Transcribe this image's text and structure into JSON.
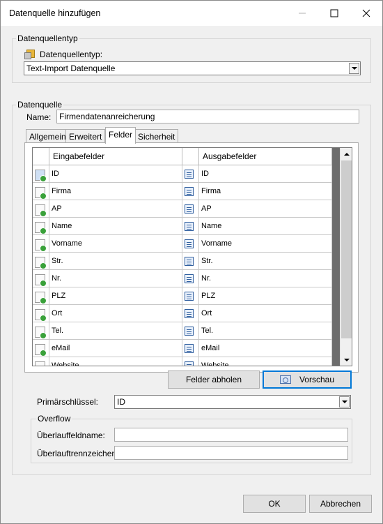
{
  "window": {
    "title": "Datenquelle hinzufügen",
    "controls": {
      "minimize": "—",
      "maximize": "☐",
      "close": "✕"
    }
  },
  "datasource_type_group": {
    "label": "Datenquellentyp",
    "field_label": "Datenquellentyp:",
    "selected": "Text-Import Datenquelle",
    "icon": "database-icon"
  },
  "datasource_group": {
    "label": "Datenquelle",
    "name_label": "Name:",
    "name_value": "Firmendatenanreicherung"
  },
  "tabs": [
    {
      "label": "Allgemein",
      "active": false
    },
    {
      "label": "Erweitert",
      "active": false
    },
    {
      "label": "Felder",
      "active": true
    },
    {
      "label": "Sicherheit",
      "active": false
    }
  ],
  "fields_grid": {
    "columns": [
      "Eingabefelder",
      "Ausgabefelder"
    ],
    "rows": [
      {
        "input": "ID",
        "output": "ID",
        "selected": true
      },
      {
        "input": "Firma",
        "output": "Firma"
      },
      {
        "input": "AP",
        "output": "AP"
      },
      {
        "input": "Name",
        "output": "Name"
      },
      {
        "input": "Vorname",
        "output": "Vorname"
      },
      {
        "input": "Str.",
        "output": "Str."
      },
      {
        "input": "Nr.",
        "output": "Nr."
      },
      {
        "input": "PLZ",
        "output": "PLZ"
      },
      {
        "input": "Ort",
        "output": "Ort"
      },
      {
        "input": "Tel.",
        "output": "Tel."
      },
      {
        "input": "eMail",
        "output": "eMail"
      },
      {
        "input": "Website",
        "output": "Website"
      }
    ]
  },
  "buttons": {
    "fetch_fields": "Felder abholen",
    "preview": "Vorschau",
    "ok": "OK",
    "cancel": "Abbrechen"
  },
  "primary_key": {
    "label": "Primärschlüssel:",
    "value": "ID"
  },
  "overflow_group": {
    "label": "Overflow",
    "field_name_label": "Überlauffeldname:",
    "field_name_value": "",
    "separator_label": "Überlauftrennzeichen:",
    "separator_value": ""
  }
}
